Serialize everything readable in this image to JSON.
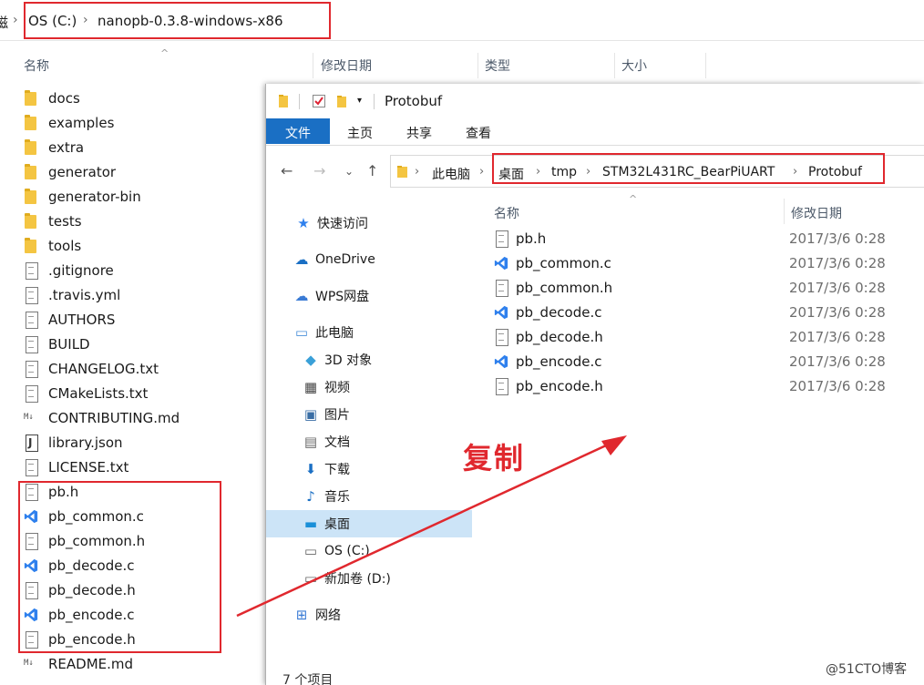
{
  "colors": {
    "accent": "#1a6fc4",
    "highlight": "#e0282e",
    "selected": "#cce4f7",
    "folder": "#f4c542",
    "vscode": "#2f80ed"
  },
  "background_window": {
    "breadcrumb": [
      "磁",
      "OS (C:)",
      "nanopb-0.3.8-windows-x86"
    ],
    "columns": [
      "名称",
      "修改日期",
      "类型",
      "大小"
    ],
    "items": [
      {
        "name": "docs",
        "icon": "folder-icon"
      },
      {
        "name": "examples",
        "icon": "folder-icon"
      },
      {
        "name": "extra",
        "icon": "folder-icon"
      },
      {
        "name": "generator",
        "icon": "folder-icon"
      },
      {
        "name": "generator-bin",
        "icon": "folder-icon"
      },
      {
        "name": "tests",
        "icon": "folder-icon"
      },
      {
        "name": "tools",
        "icon": "folder-icon"
      },
      {
        "name": ".gitignore",
        "icon": "file-icon"
      },
      {
        "name": ".travis.yml",
        "icon": "file-icon"
      },
      {
        "name": "AUTHORS",
        "icon": "file-icon"
      },
      {
        "name": "BUILD",
        "icon": "file-icon"
      },
      {
        "name": "CHANGELOG.txt",
        "icon": "file-icon"
      },
      {
        "name": "CMakeLists.txt",
        "icon": "file-icon"
      },
      {
        "name": "CONTRIBUTING.md",
        "icon": "markdown-icon"
      },
      {
        "name": "library.json",
        "icon": "json-icon"
      },
      {
        "name": "LICENSE.txt",
        "icon": "file-icon"
      },
      {
        "name": "pb.h",
        "icon": "file-icon"
      },
      {
        "name": "pb_common.c",
        "icon": "vscode-icon"
      },
      {
        "name": "pb_common.h",
        "icon": "file-icon"
      },
      {
        "name": "pb_decode.c",
        "icon": "vscode-icon"
      },
      {
        "name": "pb_decode.h",
        "icon": "file-icon"
      },
      {
        "name": "pb_encode.c",
        "icon": "vscode-icon"
      },
      {
        "name": "pb_encode.h",
        "icon": "file-icon"
      },
      {
        "name": "README.md",
        "icon": "markdown-icon"
      }
    ]
  },
  "foreground_window": {
    "title": "Protobuf",
    "ribbon_tabs": [
      "文件",
      "主页",
      "共享",
      "查看"
    ],
    "breadcrumb_root": "此电脑",
    "breadcrumb": [
      "桌面",
      "tmp",
      "STM32L431RC_BearPiUART",
      "Protobuf"
    ],
    "sidebar": [
      {
        "label": "快速访问",
        "icon": "star-icon"
      },
      {
        "label": "OneDrive",
        "icon": "cloud-icon"
      },
      {
        "label": "WPS网盘",
        "icon": "wps-cloud-icon"
      },
      {
        "label": "此电脑",
        "icon": "computer-icon"
      },
      {
        "label": "3D 对象",
        "icon": "cube-icon"
      },
      {
        "label": "视频",
        "icon": "video-icon"
      },
      {
        "label": "图片",
        "icon": "picture-icon"
      },
      {
        "label": "文档",
        "icon": "document-icon"
      },
      {
        "label": "下载",
        "icon": "download-icon"
      },
      {
        "label": "音乐",
        "icon": "music-icon"
      },
      {
        "label": "桌面",
        "icon": "desktop-icon"
      },
      {
        "label": "OS (C:)",
        "icon": "drive-c-icon"
      },
      {
        "label": "新加卷 (D:)",
        "icon": "drive-d-icon"
      },
      {
        "label": "网络",
        "icon": "network-icon"
      }
    ],
    "columns": [
      "名称",
      "修改日期"
    ],
    "files": [
      {
        "name": "pb.h",
        "date": "2017/3/6 0:28",
        "icon": "file-icon"
      },
      {
        "name": "pb_common.c",
        "date": "2017/3/6 0:28",
        "icon": "vscode-icon"
      },
      {
        "name": "pb_common.h",
        "date": "2017/3/6 0:28",
        "icon": "file-icon"
      },
      {
        "name": "pb_decode.c",
        "date": "2017/3/6 0:28",
        "icon": "vscode-icon"
      },
      {
        "name": "pb_decode.h",
        "date": "2017/3/6 0:28",
        "icon": "file-icon"
      },
      {
        "name": "pb_encode.c",
        "date": "2017/3/6 0:28",
        "icon": "vscode-icon"
      },
      {
        "name": "pb_encode.h",
        "date": "2017/3/6 0:28",
        "icon": "file-icon"
      }
    ],
    "status": "7 个项目"
  },
  "annotation": "复制",
  "watermark": "@51CTO博客"
}
